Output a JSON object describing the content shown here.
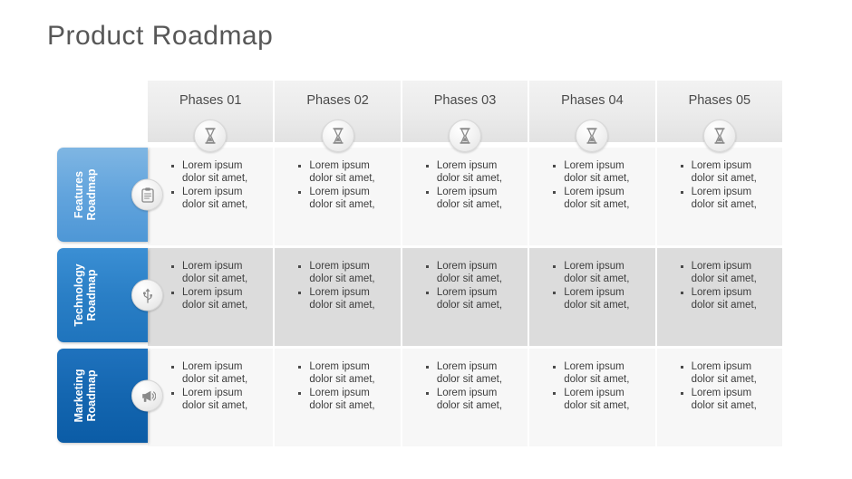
{
  "title": "Product Roadmap",
  "colors": {
    "title_text": "#575757",
    "header_bg": "#ebebeb",
    "row_light": "#f7f7f7",
    "row_dark": "#dcdcdc",
    "tab_light_blue": "#62a4dd",
    "tab_mid_blue": "#2a7fc6",
    "tab_dark_blue": "#1466b0",
    "text": "#3d3d3d"
  },
  "phases": [
    {
      "label": "Phases 01",
      "icon": "hourglass-icon"
    },
    {
      "label": "Phases 02",
      "icon": "hourglass-icon"
    },
    {
      "label": "Phases 03",
      "icon": "hourglass-icon"
    },
    {
      "label": "Phases 04",
      "icon": "hourglass-icon"
    },
    {
      "label": "Phases 05",
      "icon": "hourglass-icon"
    }
  ],
  "rows": [
    {
      "label": "Features Roadmap",
      "icon": "clipboard-icon",
      "cells": [
        [
          "Lorem ipsum dolor sit amet,",
          "Lorem ipsum dolor sit amet,"
        ],
        [
          "Lorem ipsum dolor sit amet,",
          "Lorem ipsum dolor sit amet,"
        ],
        [
          "Lorem ipsum dolor sit amet,",
          "Lorem ipsum dolor sit amet,"
        ],
        [
          "Lorem ipsum dolor sit amet,",
          "Lorem ipsum dolor sit amet,"
        ],
        [
          "Lorem ipsum dolor sit amet,",
          "Lorem ipsum dolor sit amet,"
        ]
      ]
    },
    {
      "label": "Technology Roadmap",
      "icon": "usb-icon",
      "cells": [
        [
          "Lorem ipsum dolor sit amet,",
          "Lorem ipsum dolor sit amet,"
        ],
        [
          "Lorem ipsum dolor sit amet,",
          "Lorem ipsum dolor sit amet,"
        ],
        [
          "Lorem ipsum dolor sit amet,",
          "Lorem ipsum dolor sit amet,"
        ],
        [
          "Lorem ipsum dolor sit amet,",
          "Lorem ipsum dolor sit amet,"
        ],
        [
          "Lorem ipsum dolor sit amet,",
          "Lorem ipsum dolor sit amet,"
        ]
      ]
    },
    {
      "label": "Marketing Roadmap",
      "icon": "megaphone-icon",
      "cells": [
        [
          "Lorem ipsum dolor sit amet,",
          "Lorem ipsum dolor sit amet,"
        ],
        [
          "Lorem ipsum dolor sit amet,",
          "Lorem ipsum dolor sit amet,"
        ],
        [
          "Lorem ipsum dolor sit amet,",
          "Lorem ipsum dolor sit amet,"
        ],
        [
          "Lorem ipsum dolor sit amet,",
          "Lorem ipsum dolor sit amet,"
        ],
        [
          "Lorem ipsum dolor sit amet,",
          "Lorem ipsum dolor sit amet,"
        ]
      ]
    }
  ]
}
